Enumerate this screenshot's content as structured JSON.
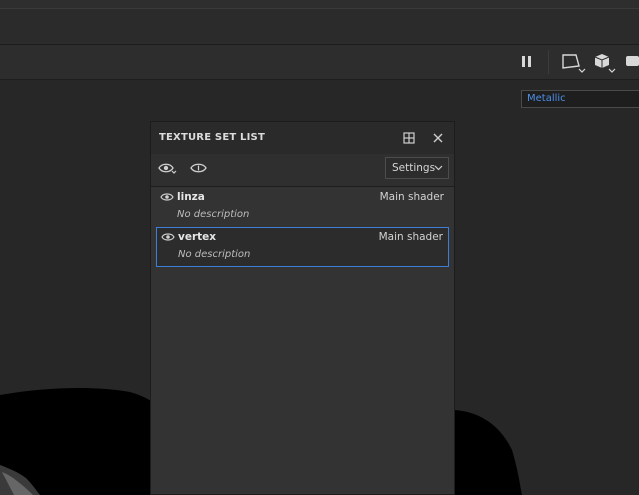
{
  "toolbar": {
    "icons": [
      "pause-icon",
      "camera-view-icon",
      "cube-icon",
      "display-icon"
    ]
  },
  "viewport": {
    "channel": "Metallic"
  },
  "panel": {
    "title": "TEXTURE SET LIST",
    "settings_label": "Settings",
    "items": [
      {
        "name": "linza",
        "shader": "Main shader",
        "description": "No description",
        "selected": false
      },
      {
        "name": "vertex",
        "shader": "Main shader",
        "description": "No description",
        "selected": true
      }
    ]
  },
  "colors": {
    "accent": "#3d7fd6",
    "channel_text": "#4d8fe8"
  }
}
